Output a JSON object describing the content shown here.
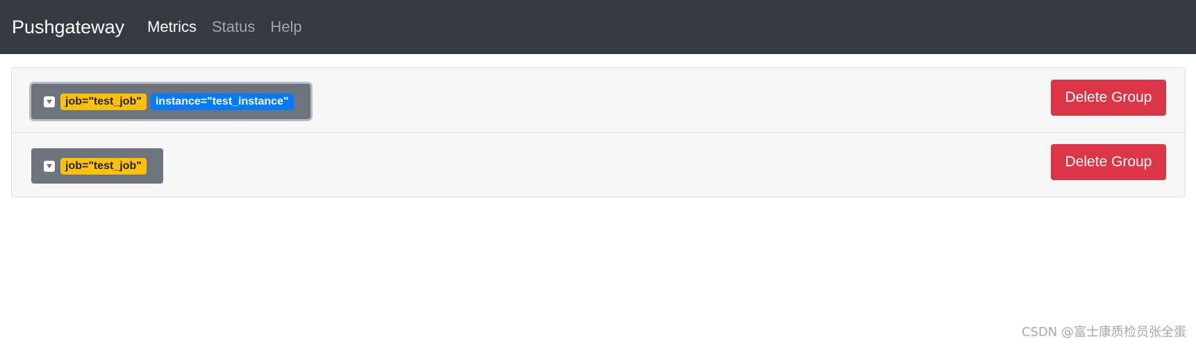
{
  "navbar": {
    "brand": "Pushgateway",
    "links": [
      {
        "label": "Metrics",
        "active": true
      },
      {
        "label": "Status",
        "active": false
      },
      {
        "label": "Help",
        "active": false
      }
    ],
    "background": "#343a40"
  },
  "groups": [
    {
      "labels": [
        {
          "text": "job=\"test_job\"",
          "color": "#ffc107"
        },
        {
          "text": "instance=\"test_instance\"",
          "color": "#007bff"
        }
      ],
      "delete_label": "Delete Group"
    },
    {
      "labels": [
        {
          "text": "job=\"test_job\"",
          "color": "#ffc107"
        }
      ],
      "delete_label": "Delete Group"
    }
  ],
  "icons": {
    "toggle": "caret-down-square-icon"
  },
  "colors": {
    "danger": "#dc3545",
    "secondary": "#6c757d"
  },
  "watermark": "CSDN @富士康质检员张全蛋"
}
